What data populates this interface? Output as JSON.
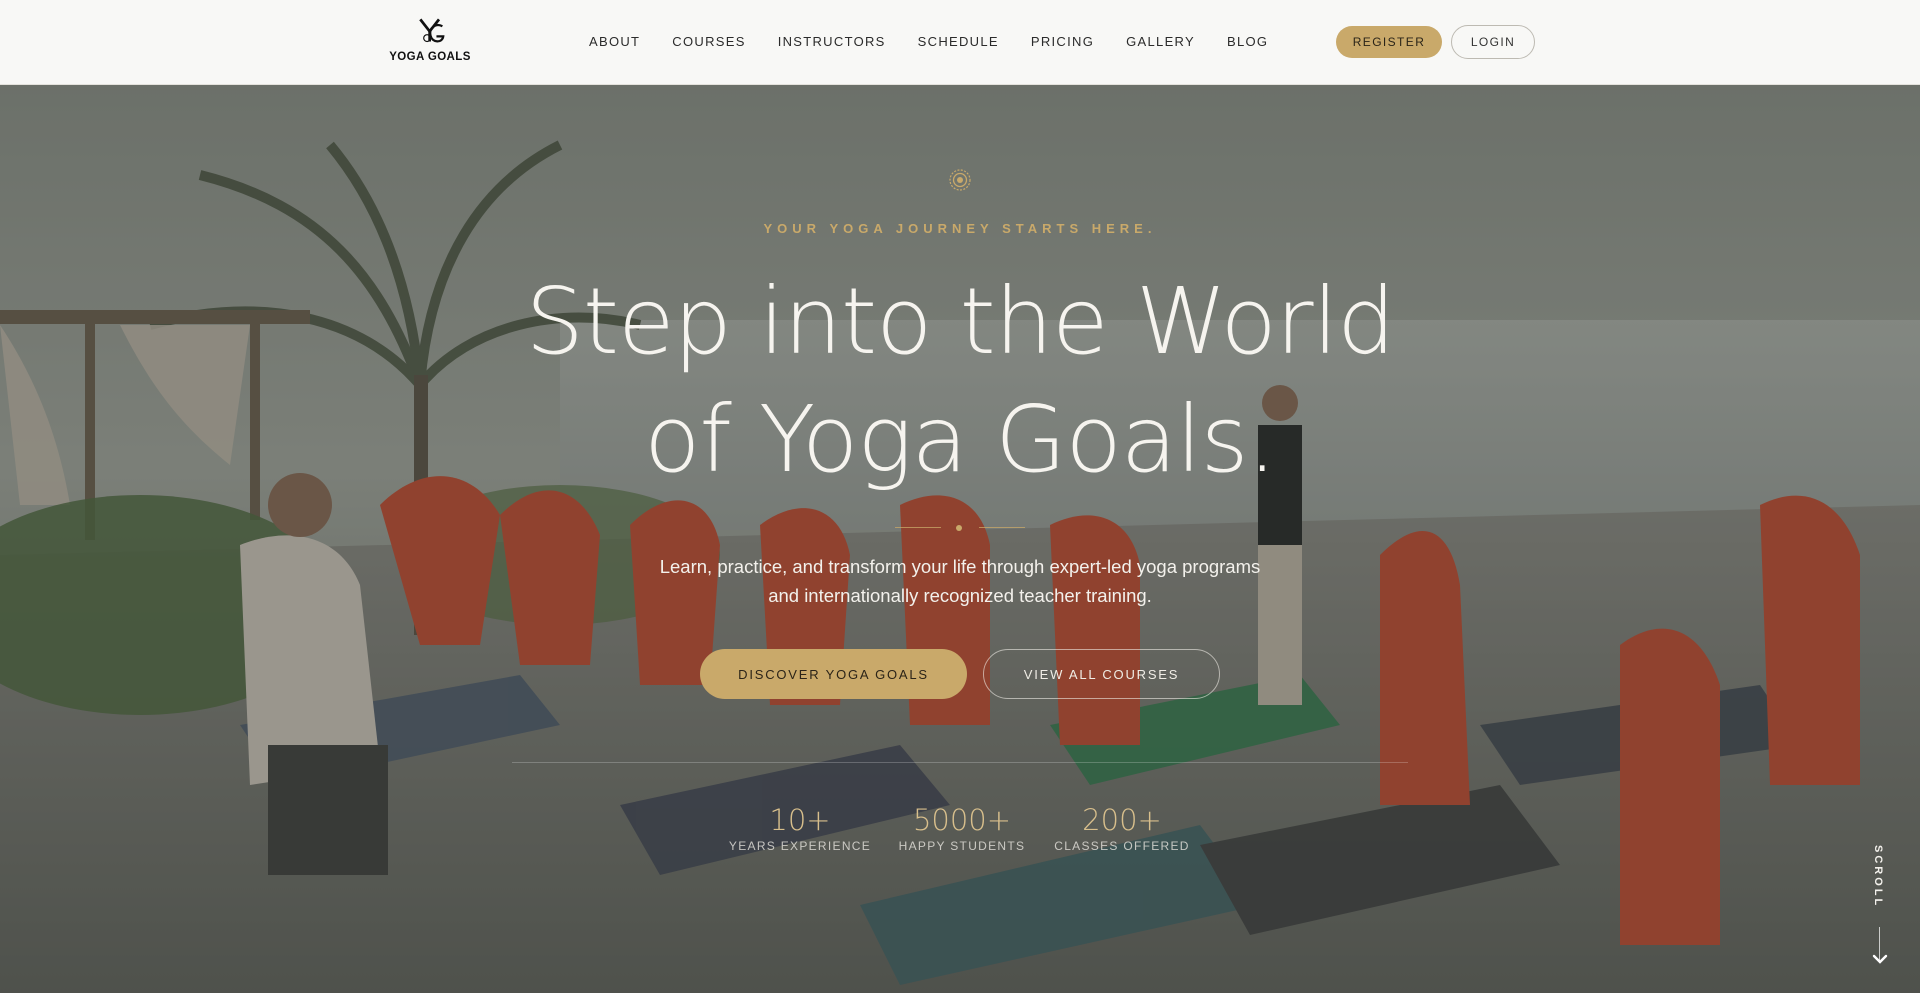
{
  "header": {
    "logo": {
      "mark": "YG",
      "text": "YOGA GOALS"
    },
    "nav": [
      {
        "label": "ABOUT"
      },
      {
        "label": "COURSES"
      },
      {
        "label": "INSTRUCTORS"
      },
      {
        "label": "SCHEDULE"
      },
      {
        "label": "PRICING"
      },
      {
        "label": "GALLERY"
      },
      {
        "label": "BLOG"
      }
    ],
    "register_label": "REGISTER",
    "login_label": "LOGIN"
  },
  "hero": {
    "icon": "sun-mandala-icon",
    "eyebrow": "YOUR YOGA JOURNEY STARTS HERE.",
    "headline_line1": "Step into the World",
    "headline_line2": "of Yoga Goals.",
    "subtitle_line1": "Learn, practice, and transform your life through expert-led yoga programs",
    "subtitle_line2": "and internationally recognized teacher training.",
    "primary_cta": "DISCOVER YOGA GOALS",
    "secondary_cta": "VIEW ALL COURSES",
    "stats": [
      {
        "value": "10+",
        "label": "YEARS EXPERIENCE"
      },
      {
        "value": "5000+",
        "label": "HAPPY STUDENTS"
      },
      {
        "value": "200+",
        "label": "CLASSES OFFERED"
      }
    ],
    "scroll_label": "SCROLL"
  },
  "colors": {
    "accent_gold": "#c9a96a",
    "header_bg": "#f8f8f6",
    "overlay": "#343832"
  }
}
